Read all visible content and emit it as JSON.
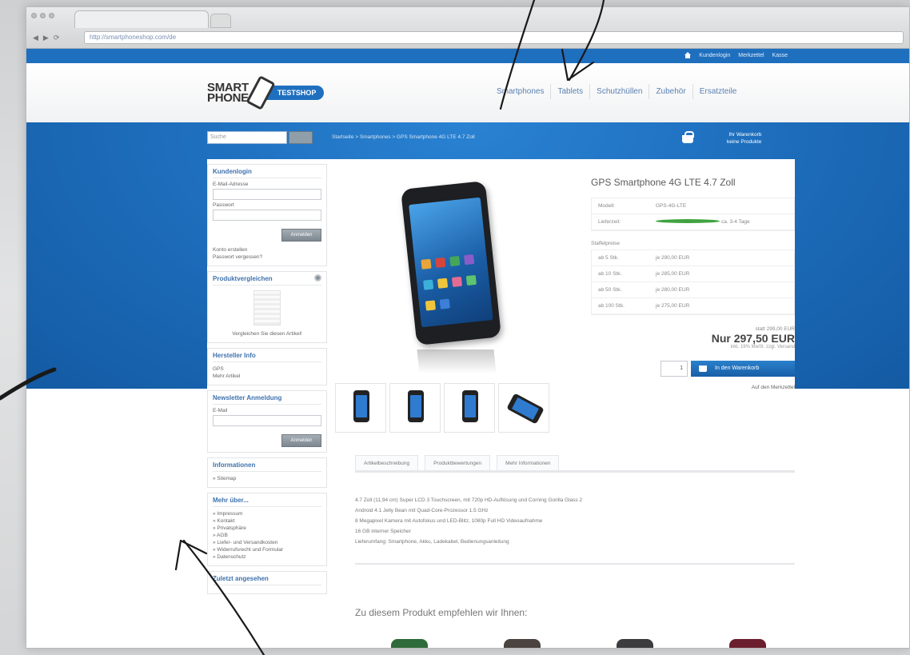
{
  "browser": {
    "url": "http://smartphoneshop.com/de"
  },
  "topbar": {
    "links": [
      "Kundenlogin",
      "Merkzettel",
      "Kasse"
    ]
  },
  "header": {
    "logo_line1": "SMART",
    "logo_line2": "PHONE",
    "logo_badge": "TESTSHOP",
    "nav": [
      "Smartphones",
      "Tablets",
      "Schutzhüllen",
      "Zubehör",
      "Ersatzteile"
    ]
  },
  "band": {
    "search_placeholder": "Suche",
    "breadcrumb": "Startseite > Smartphones > GPS Smartphone 4G LTE 4.7 Zoll",
    "cart_label": "Ihr Warenkorb",
    "cart_sub": "keine Produkte"
  },
  "sidebar": {
    "login_title": "Kundenlogin",
    "email_label": "E-Mail-Adresse",
    "password_label": "Passwort",
    "login_button": "Anmelden",
    "register_link": "Konto erstellen",
    "forgot_link": "Passwort vergessen?",
    "compare_title": "Produktvergleichen",
    "compare_text": "Vergleichen Sie diesen Artikel!",
    "maker_title": "Hersteller Info",
    "maker_lines": [
      "GPS",
      "Mehr Artikel"
    ],
    "newsletter_title": "Newsletter Anmeldung",
    "newsletter_label": "E-Mail",
    "newsletter_button": "Anmelden",
    "info_title": "Informationen",
    "info_link": "» Sitemap",
    "more_title": "Mehr über...",
    "more_links": [
      "» Impressum",
      "» Kontakt",
      "» Privatsphäre",
      "» AGB",
      "» Liefer- und Versandkosten",
      "» Widerrufsrecht und Formular",
      "» Datenschutz"
    ],
    "bottom_title": "Zuletzt angesehen"
  },
  "product": {
    "title": "GPS Smartphone 4G LTE 4.7 Zoll",
    "rows": [
      [
        "Modell:",
        "GPS-4G-LTE"
      ],
      [
        "Lieferzeit:",
        "ca. 3-4 Tage"
      ]
    ],
    "graduated_title": "Staffelpreise",
    "graduated": [
      [
        "ab 5 Stk.",
        "je 290,00 EUR"
      ],
      [
        "ab 10 Stk.",
        "je 285,00 EUR"
      ],
      [
        "ab 50 Stk.",
        "je 280,00 EUR"
      ],
      [
        "ab 100 Stk.",
        "je 275,00 EUR"
      ]
    ],
    "price_old": "statt 299,00 EUR",
    "price": "Nur 297,50 EUR",
    "price_note": "inkl. 19% MwSt. zzgl. Versand",
    "qty": "1",
    "cart_button": "In den Warenkorb",
    "wishlist": "Auf den Merkzettel",
    "tabs": [
      "Artikelbeschreibung",
      "Produktbewertungen",
      "Mehr Informationen"
    ],
    "description": [
      "4.7 Zoll (11,94 cm) Super LCD 3 Touchscreen, mit 720p HD-Auflösung und Corning Gorilla Glass 2",
      "Android 4.1 Jelly Bean mit Quad-Core-Prozessor 1.5 GHz",
      "8 Megapixel Kamera mit Autofokus und LED-Blitz, 1080p Full HD Videoaufnahme",
      "16 GB interner Speicher",
      "Lieferumfang: Smartphone, Akku, Ladekabel, Bedienungsanleitung"
    ],
    "recommend_title": "Zu diesem Produkt empfehlen wir Ihnen:"
  },
  "colors": {
    "brand_blue": "#1f6fbf",
    "link_blue": "#3f72ad",
    "stock_green": "#3fa33f",
    "rec_colors": [
      "#2f6b3a",
      "#4a433f",
      "#3c3c3e",
      "#6b1f2e"
    ]
  }
}
